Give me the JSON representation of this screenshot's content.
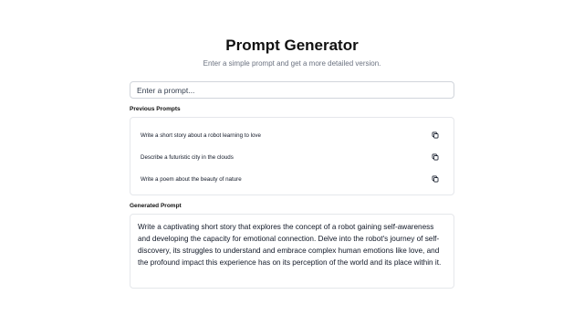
{
  "header": {
    "title": "Prompt Generator",
    "subtitle": "Enter a simple prompt and get a more detailed version."
  },
  "input": {
    "placeholder": "Enter a prompt...",
    "value": ""
  },
  "previous": {
    "label": "Previous Prompts",
    "items": [
      {
        "text": "Write a short story about a robot learning to love",
        "icon": "copy-icon"
      },
      {
        "text": "Describe a futuristic city in the clouds",
        "icon": "copy-icon"
      },
      {
        "text": "Write a poem about the beauty of nature",
        "icon": "copy-icon"
      }
    ]
  },
  "generated": {
    "label": "Generated Prompt",
    "text": "Write a captivating short story that explores the concept of a robot gaining self-awareness and developing the capacity for emotional connection. Delve into the robot's journey of self-discovery, its struggles to understand and embrace complex human emotions like love, and the profound impact this experience has on its perception of the world and its place within it."
  },
  "colors": {
    "border": "#e5e7eb",
    "input_border": "#d1d5db",
    "subtitle": "#6b7280",
    "text": "#111827"
  }
}
